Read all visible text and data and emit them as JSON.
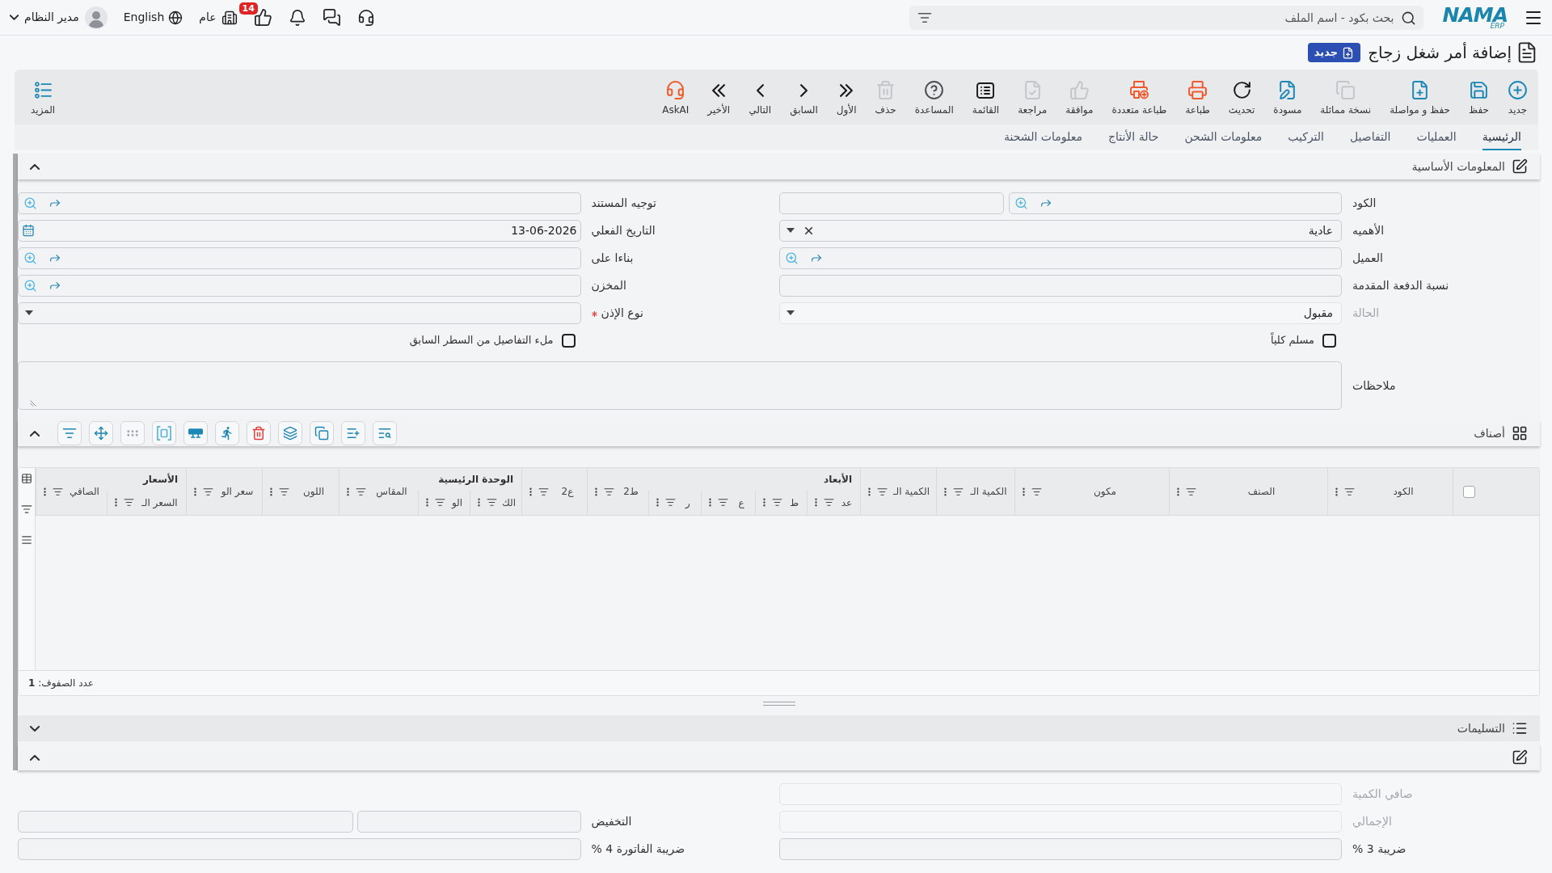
{
  "top_bar": {
    "logo": {
      "name": "NAMA",
      "suffix": "ERP"
    },
    "search": {
      "placeholder": "بحث بكود - اسم الملف"
    },
    "likes_badge": "14",
    "company": "عام",
    "language": "English",
    "user": "مدير النظام"
  },
  "page_header": {
    "title": "إضافة أمر شغل زجاج",
    "status_badge": "جديد"
  },
  "toolbar": {
    "actions": [
      {
        "kind": "new",
        "label": "جديد",
        "disabled": false
      },
      {
        "kind": "save",
        "label": "حفظ",
        "disabled": false
      },
      {
        "kind": "save-continue",
        "label": "حفظ و مواصلة",
        "disabled": false
      },
      {
        "kind": "duplicate",
        "label": "نسخة مماثلة",
        "disabled": true
      },
      {
        "kind": "draft",
        "label": "مسودة",
        "disabled": false
      },
      {
        "kind": "refresh",
        "label": "تحديث",
        "disabled": false
      },
      {
        "kind": "print",
        "label": "طباعة",
        "disabled": false
      },
      {
        "kind": "multiprint",
        "label": "طباعة متعددة",
        "disabled": false
      },
      {
        "kind": "approve",
        "label": "موافقة",
        "disabled": true
      },
      {
        "kind": "review",
        "label": "مراجعة",
        "disabled": true
      },
      {
        "kind": "list",
        "label": "القائمة",
        "disabled": false
      },
      {
        "kind": "help",
        "label": "المساعدة",
        "disabled": false
      },
      {
        "kind": "delete",
        "label": "حذف",
        "disabled": true
      },
      {
        "kind": "first",
        "label": "الأول",
        "disabled": false
      },
      {
        "kind": "previous",
        "label": "السابق",
        "disabled": false
      },
      {
        "kind": "next",
        "label": "التالي",
        "disabled": false
      },
      {
        "kind": "last",
        "label": "الأخير",
        "disabled": false
      },
      {
        "kind": "ai",
        "label": "AskAI",
        "disabled": false
      }
    ],
    "more": "المزيد"
  },
  "tabs": [
    {
      "label": "الرئيسية",
      "selected": true
    },
    {
      "label": "العمليات",
      "selected": false
    },
    {
      "label": "التفاصيل",
      "selected": false
    },
    {
      "label": "التركيب",
      "selected": false
    },
    {
      "label": "معلومات الشحن",
      "selected": false
    },
    {
      "label": "حالة الأنتاج",
      "selected": false
    },
    {
      "label": "معلومات الشحنة",
      "selected": false
    }
  ],
  "basic_info": {
    "title": "المعلومات الأساسية",
    "expanded": true,
    "rows": [
      [
        {
          "kind": "code",
          "label": "الكود",
          "required": false,
          "disabled": false
        },
        {
          "kind": "lookup",
          "label": "توجيه المستند",
          "required": false,
          "disabled": false
        }
      ],
      [
        {
          "kind": "select",
          "label": "الأهميه",
          "value": "عادية",
          "clearable": true,
          "required": false,
          "disabled": false
        },
        {
          "kind": "date",
          "label": "التاريخ الفعلي",
          "value": "13-06-2026",
          "required": false,
          "disabled": false
        }
      ],
      [
        {
          "kind": "lookup",
          "label": "العميل",
          "required": false,
          "disabled": false
        },
        {
          "kind": "lookup",
          "label": "بناءا على",
          "required": false,
          "disabled": false
        }
      ],
      [
        {
          "kind": "text",
          "label": "نسبة الدفعة المقدمة",
          "required": false,
          "disabled": false
        },
        {
          "kind": "lookup",
          "label": "المخزن",
          "required": false,
          "disabled": false
        }
      ],
      [
        {
          "kind": "select",
          "label": "الحالة",
          "value": "مقبول",
          "clearable": false,
          "required": false,
          "disabled": true
        },
        {
          "kind": "select",
          "label": "نوع الإذن",
          "clearable": false,
          "required": true,
          "disabled": false
        }
      ],
      [
        {
          "kind": "checkbox",
          "label": "مسلم كلياً",
          "checked": false,
          "required": false,
          "disabled": false
        },
        {
          "kind": "checkbox",
          "label": "ملء التفاصيل من السطر السابق",
          "checked": false,
          "required": false,
          "disabled": false
        }
      ],
      [
        {
          "kind": "textarea",
          "label": "ملاحظات",
          "required": false,
          "disabled": false
        }
      ]
    ]
  },
  "items": {
    "title": "أصناف",
    "expanded": true,
    "tools": [
      {
        "kind": "find",
        "disabled": false
      },
      {
        "kind": "add-row",
        "disabled": false
      },
      {
        "kind": "copy",
        "disabled": false
      },
      {
        "kind": "layers",
        "disabled": false
      },
      {
        "kind": "delete",
        "disabled": false
      },
      {
        "kind": "run",
        "disabled": false
      },
      {
        "kind": "rows",
        "disabled": false
      },
      {
        "kind": "fit",
        "disabled": false
      },
      {
        "kind": "grid",
        "disabled": true
      },
      {
        "kind": "move",
        "disabled": false
      },
      {
        "kind": "filter",
        "disabled": false
      }
    ],
    "select_all": {
      "checked": false
    },
    "columns": [
      {
        "label": "الكود"
      },
      {
        "label": "الصنف"
      },
      {
        "label": "مكون"
      },
      {
        "label": "الكمية الـ"
      },
      {
        "label": "الكمية الـ"
      },
      {
        "label": "الأبعاد",
        "children": [
          {
            "label": "عد"
          },
          {
            "label": "ط"
          },
          {
            "label": "ع"
          },
          {
            "label": "ر"
          }
        ]
      },
      {
        "label": "ط2"
      },
      {
        "label": "ع2"
      },
      {
        "label": "الوحدة الرئيسية",
        "children": [
          {
            "label": "الك"
          },
          {
            "label": "الو"
          }
        ]
      },
      {
        "label": "المقاس"
      },
      {
        "label": "اللون"
      },
      {
        "label": "سعر الو"
      },
      {
        "label": "الأسعار",
        "children": [
          {
            "label": "السعر الـ"
          }
        ]
      },
      {
        "label": "الصافي"
      }
    ],
    "row_count": "عدد الصفوف: **1**"
  },
  "deliveries": {
    "title": "التسليمات",
    "expanded": false
  },
  "totals": {
    "expanded": true,
    "rows": [
      [
        {
          "kind": "text",
          "label": "صافي الكمية",
          "required": false,
          "disabled": true
        }
      ],
      [
        {
          "kind": "text",
          "label": "الإجمالي",
          "required": false,
          "disabled": true
        },
        {
          "kind": "pair",
          "label": "التخفيض",
          "required": false,
          "disabled": false
        }
      ],
      [
        {
          "kind": "text",
          "label": "ضريبة 3 %",
          "required": false,
          "disabled": false
        },
        {
          "kind": "text",
          "label": "ضريبة الفاتورة 4 %",
          "required": false,
          "disabled": false
        }
      ]
    ]
  }
}
